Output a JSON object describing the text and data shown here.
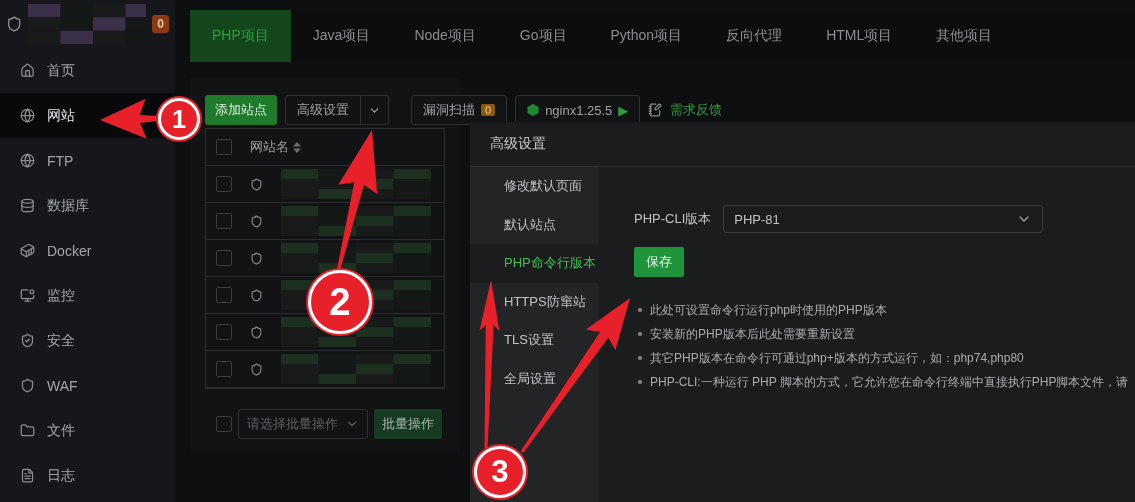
{
  "sidebar": {
    "badge": "0",
    "items": [
      {
        "label": "首页",
        "selected": false
      },
      {
        "label": "网站",
        "selected": true
      },
      {
        "label": "FTP",
        "selected": false
      },
      {
        "label": "数据库",
        "selected": false
      },
      {
        "label": "Docker",
        "selected": false
      },
      {
        "label": "监控",
        "selected": false
      },
      {
        "label": "安全",
        "selected": false
      },
      {
        "label": "WAF",
        "selected": false
      },
      {
        "label": "文件",
        "selected": false
      },
      {
        "label": "日志",
        "selected": false
      }
    ]
  },
  "tabs": [
    {
      "label": "PHP项目",
      "selected": true
    },
    {
      "label": "Java项目",
      "selected": false
    },
    {
      "label": "Node项目",
      "selected": false
    },
    {
      "label": "Go项目",
      "selected": false
    },
    {
      "label": "Python项目",
      "selected": false
    },
    {
      "label": "反向代理",
      "selected": false
    },
    {
      "label": "HTML项目",
      "selected": false
    },
    {
      "label": "其他项目",
      "selected": false
    }
  ],
  "toolbar": {
    "add_button": "添加站点",
    "advanced_button": "高级设置",
    "scan_button": "漏洞扫描",
    "scan_count": "0",
    "nginx": "nginx1.25.5",
    "play": "▶",
    "feedback": "需求反馈"
  },
  "table": {
    "columns": [
      "网站名"
    ],
    "select_all_checked": false,
    "batch_checked": false,
    "row_count_checkboxes": [
      {
        "checked": false
      },
      {
        "checked": false
      },
      {
        "checked": false
      },
      {
        "checked": false
      },
      {
        "checked": false
      },
      {
        "checked": false
      }
    ],
    "batch_placeholder": "请选择批量操作",
    "batch_button": "批量操作"
  },
  "dialog": {
    "title": "高级设置",
    "menu": [
      {
        "label": "修改默认页面",
        "selected": false
      },
      {
        "label": "默认站点",
        "selected": false
      },
      {
        "label": "PHP命令行版本",
        "selected": true
      },
      {
        "label": "HTTPS防窜站",
        "selected": false
      },
      {
        "label": "TLS设置",
        "selected": false
      },
      {
        "label": "全局设置",
        "selected": false
      }
    ],
    "field_label": "PHP-CLI版本",
    "field_value": "PHP-81",
    "save_button": "保存",
    "notes": [
      "此处可设置命令行运行php时使用的PHP版本",
      "安装新的PHP版本后此处需要重新设置",
      "其它PHP版本在命令行可通过php+版本的方式运行，如：php74,php80",
      "PHP-CLI:一种运行 PHP 脚本的方式，它允许您在命令行终端中直接执行PHP脚本文件，请"
    ]
  },
  "annotations": [
    "1",
    "2",
    "3"
  ]
}
